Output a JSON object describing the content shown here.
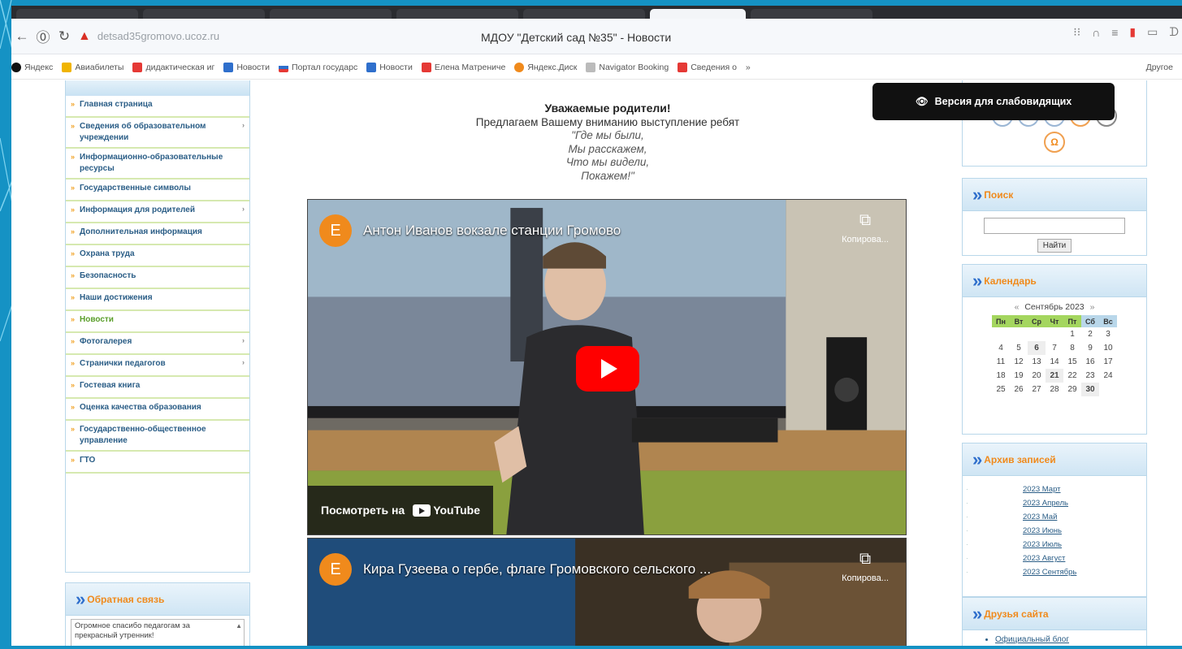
{
  "browser": {
    "url": "detsad35gromovo.ucoz.ru",
    "title": "МДОУ \"Детский сад №35\" - Новости"
  },
  "bookmarks": [
    {
      "label": "Яндекс",
      "color": "#111111",
      "icon": "Я"
    },
    {
      "label": "Авиабилеты",
      "color": "#f0b400",
      "icon": "✈"
    },
    {
      "label": "дидактическая иг",
      "color": "#e53935",
      "icon": "▶"
    },
    {
      "label": "Новости",
      "color": "#2f6fcc",
      "icon": "N"
    },
    {
      "label": "Портал государс",
      "color": "#2f6fcc",
      "icon": "◆"
    },
    {
      "label": "Новости",
      "color": "#2f6fcc",
      "icon": "N"
    },
    {
      "label": "Елена Матрениче",
      "color": "#e53935",
      "icon": "▶"
    },
    {
      "label": "Яндекс.Диск",
      "color": "#f08a1c",
      "icon": "●"
    },
    {
      "label": "Navigator Booking",
      "color": "#999999",
      "icon": "✈"
    },
    {
      "label": "Сведения о",
      "color": "#e53935",
      "icon": "▶"
    }
  ],
  "bookmarks_other": "Другое",
  "left_menu": [
    {
      "label": "Главная страница",
      "arrow": false,
      "current": false
    },
    {
      "label": "Сведения об образовательном учреждении",
      "arrow": true,
      "current": false
    },
    {
      "label": "Информационно-образовательные ресурсы",
      "arrow": false,
      "current": false
    },
    {
      "label": "Государственные символы",
      "arrow": false,
      "current": false
    },
    {
      "label": "Информация для родителей",
      "arrow": true,
      "current": false
    },
    {
      "label": "Дополнительная информация",
      "arrow": false,
      "current": false
    },
    {
      "label": "Охрана труда",
      "arrow": false,
      "current": false
    },
    {
      "label": "Безопасность",
      "arrow": false,
      "current": false
    },
    {
      "label": "Наши достижения",
      "arrow": false,
      "current": false
    },
    {
      "label": "Новости",
      "arrow": false,
      "current": true
    },
    {
      "label": "Фотогалерея",
      "arrow": true,
      "current": false
    },
    {
      "label": "Странички педагогов",
      "arrow": true,
      "current": false
    },
    {
      "label": "Гостевая книга",
      "arrow": false,
      "current": false
    },
    {
      "label": "Оценка качества образования",
      "arrow": false,
      "current": false
    },
    {
      "label": "Государственно-общественное управление",
      "arrow": false,
      "current": false
    },
    {
      "label": "ГТО",
      "arrow": false,
      "current": false
    }
  ],
  "feedback": {
    "title": "Обратная связь",
    "text": "Огромное спасибо педагогам за прекрасный утренник!"
  },
  "content": {
    "heading": "Уважаемые родители!",
    "subheading": "Предлагаем Вашему вниманию выступление ребят",
    "poem": [
      "\"Где мы были,",
      "Мы расскажем,",
      "Что мы видели,",
      "Покажем!\""
    ]
  },
  "videos": [
    {
      "avatar": "E",
      "title": "Антон Иванов вокзале станции Громово",
      "copy_label": "Копирова...",
      "watch_label": "Посмотреть на",
      "yt_label": "YouTube"
    },
    {
      "avatar": "E",
      "title": "Кира Гузеева о гербе, флаге Громовского сельского ...",
      "copy_label": "Копирова..."
    }
  ],
  "accessibility_button": "Версия для слабовидящих",
  "search": {
    "title": "Поиск",
    "button": "Найти",
    "value": ""
  },
  "calendar": {
    "title": "Календарь",
    "month": "Сентябрь 2023",
    "weekdays": [
      "Пн",
      "Вт",
      "Ср",
      "Чт",
      "Пт",
      "Сб",
      "Вс"
    ],
    "weeks": [
      [
        "",
        "",
        "",
        "",
        "1",
        "2",
        "3"
      ],
      [
        "4",
        "5",
        "6",
        "7",
        "8",
        "9",
        "10"
      ],
      [
        "11",
        "12",
        "13",
        "14",
        "15",
        "16",
        "17"
      ],
      [
        "18",
        "19",
        "20",
        "21",
        "22",
        "23",
        "24"
      ],
      [
        "25",
        "26",
        "27",
        "28",
        "29",
        "30",
        ""
      ]
    ],
    "bold_days": [
      "6",
      "21",
      "30"
    ]
  },
  "archive": {
    "title": "Архив записей",
    "items": [
      "2023 Март",
      "2023 Апрель",
      "2023 Май",
      "2023 Июнь",
      "2023 Июль",
      "2023 Август",
      "2023 Сентябрь"
    ]
  },
  "friends": {
    "title": "Друзья сайта",
    "items": [
      "Официальный блог"
    ]
  }
}
